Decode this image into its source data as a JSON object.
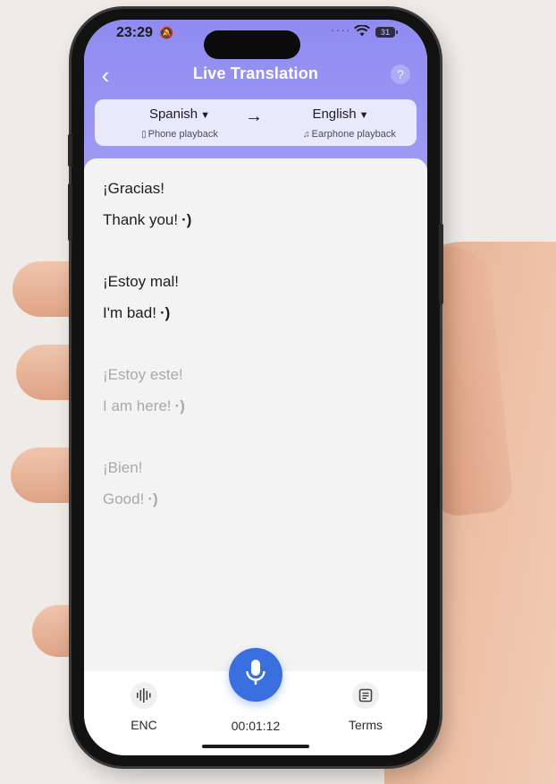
{
  "status_bar": {
    "time": "23:29",
    "battery": "31"
  },
  "header": {
    "title": "Live Translation",
    "back_icon": "chevron-left-icon",
    "help_icon": "question-icon",
    "help_label": "?"
  },
  "language_selector": {
    "source_language": "Spanish",
    "target_language": "English",
    "source_playback": "Phone playback",
    "target_playback": "Earphone playback",
    "arrow": "→"
  },
  "conversation": [
    {
      "source": "¡Gracias!",
      "translation": "Thank you!",
      "style": "active"
    },
    {
      "source": "¡Estoy mal!",
      "translation": "I'm bad!",
      "style": "active"
    },
    {
      "source": "¡Estoy este!",
      "translation": "I am here!",
      "style": "faded"
    },
    {
      "source": "¡Bien!",
      "translation": "Good!",
      "style": "faded"
    }
  ],
  "bottom_bar": {
    "enc_label": "ENC",
    "timer": "00:01:12",
    "terms_label": "Terms"
  },
  "colors": {
    "header": "#9e9bf4",
    "mic_button": "#3a6fe0",
    "faded_text": "#a9a9a9"
  }
}
